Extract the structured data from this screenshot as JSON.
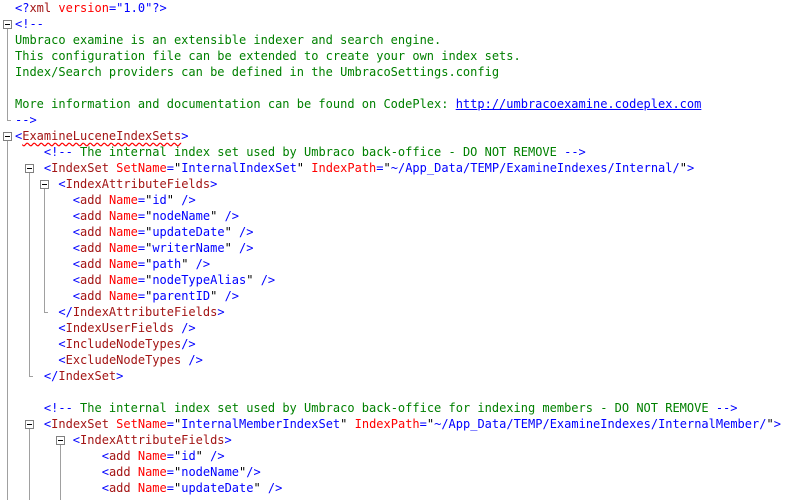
{
  "editor": {
    "lines": [
      [
        {
          "t": "<?",
          "c": "blue"
        },
        {
          "t": "xml",
          "c": "brown"
        },
        {
          "t": " version",
          "c": "red"
        },
        {
          "t": "=",
          "c": "blue"
        },
        {
          "t": "\"1.0\"",
          "c": "blue"
        },
        {
          "t": "?>",
          "c": "blue"
        }
      ],
      [
        {
          "t": "<!--",
          "c": "blue"
        }
      ],
      [
        {
          "t": "Umbraco examine is an extensible indexer and search engine.",
          "c": "green"
        }
      ],
      [
        {
          "t": "This configuration file can be extended to create your own index sets.",
          "c": "green"
        }
      ],
      [
        {
          "t": "Index/Search providers can be defined in the UmbracoSettings.config",
          "c": "green"
        }
      ],
      [],
      [
        {
          "t": "More information and documentation can be found on CodePlex: ",
          "c": "green"
        },
        {
          "t": "http://umbracoexamine.codeplex.com",
          "c": "link"
        }
      ],
      [
        {
          "t": "-->",
          "c": "blue"
        }
      ],
      [
        {
          "t": "<",
          "c": "blue"
        },
        {
          "t": "ExamineLuceneIndexSets",
          "c": "brown",
          "sq": true
        },
        {
          "t": ">",
          "c": "blue"
        }
      ],
      [
        {
          "t": "    "
        },
        {
          "t": "<!--",
          "c": "blue"
        },
        {
          "t": " The internal index set used by Umbraco back-office - DO NOT REMOVE ",
          "c": "green"
        },
        {
          "t": "-->",
          "c": "blue"
        }
      ],
      [
        {
          "t": "    "
        },
        {
          "t": "<",
          "c": "blue"
        },
        {
          "t": "IndexSet",
          "c": "brown"
        },
        {
          "t": " SetName",
          "c": "red"
        },
        {
          "t": "=",
          "c": "blue"
        },
        {
          "t": "\"",
          "c": "black"
        },
        {
          "t": "InternalIndexSet",
          "c": "blue"
        },
        {
          "t": "\"",
          "c": "black"
        },
        {
          "t": " IndexPath",
          "c": "red"
        },
        {
          "t": "=",
          "c": "blue"
        },
        {
          "t": "\"",
          "c": "black"
        },
        {
          "t": "~/App_Data/TEMP/ExamineIndexes/Internal/",
          "c": "blue"
        },
        {
          "t": "\"",
          "c": "black"
        },
        {
          "t": ">",
          "c": "blue"
        }
      ],
      [
        {
          "t": "      "
        },
        {
          "t": "<",
          "c": "blue"
        },
        {
          "t": "IndexAttributeFields",
          "c": "brown"
        },
        {
          "t": ">",
          "c": "blue"
        }
      ],
      [
        {
          "t": "        "
        },
        {
          "t": "<",
          "c": "blue"
        },
        {
          "t": "add",
          "c": "brown"
        },
        {
          "t": " Name",
          "c": "red"
        },
        {
          "t": "=",
          "c": "blue"
        },
        {
          "t": "\"",
          "c": "black"
        },
        {
          "t": "id",
          "c": "blue"
        },
        {
          "t": "\"",
          "c": "black"
        },
        {
          "t": " />",
          "c": "blue"
        }
      ],
      [
        {
          "t": "        "
        },
        {
          "t": "<",
          "c": "blue"
        },
        {
          "t": "add",
          "c": "brown"
        },
        {
          "t": " Name",
          "c": "red"
        },
        {
          "t": "=",
          "c": "blue"
        },
        {
          "t": "\"",
          "c": "black"
        },
        {
          "t": "nodeName",
          "c": "blue"
        },
        {
          "t": "\"",
          "c": "black"
        },
        {
          "t": " />",
          "c": "blue"
        }
      ],
      [
        {
          "t": "        "
        },
        {
          "t": "<",
          "c": "blue"
        },
        {
          "t": "add",
          "c": "brown"
        },
        {
          "t": " Name",
          "c": "red"
        },
        {
          "t": "=",
          "c": "blue"
        },
        {
          "t": "\"",
          "c": "black"
        },
        {
          "t": "updateDate",
          "c": "blue"
        },
        {
          "t": "\"",
          "c": "black"
        },
        {
          "t": " />",
          "c": "blue"
        }
      ],
      [
        {
          "t": "        "
        },
        {
          "t": "<",
          "c": "blue"
        },
        {
          "t": "add",
          "c": "brown"
        },
        {
          "t": " Name",
          "c": "red"
        },
        {
          "t": "=",
          "c": "blue"
        },
        {
          "t": "\"",
          "c": "black"
        },
        {
          "t": "writerName",
          "c": "blue"
        },
        {
          "t": "\"",
          "c": "black"
        },
        {
          "t": " />",
          "c": "blue"
        }
      ],
      [
        {
          "t": "        "
        },
        {
          "t": "<",
          "c": "blue"
        },
        {
          "t": "add",
          "c": "brown"
        },
        {
          "t": " Name",
          "c": "red"
        },
        {
          "t": "=",
          "c": "blue"
        },
        {
          "t": "\"",
          "c": "black"
        },
        {
          "t": "path",
          "c": "blue"
        },
        {
          "t": "\"",
          "c": "black"
        },
        {
          "t": " />",
          "c": "blue"
        }
      ],
      [
        {
          "t": "        "
        },
        {
          "t": "<",
          "c": "blue"
        },
        {
          "t": "add",
          "c": "brown"
        },
        {
          "t": " Name",
          "c": "red"
        },
        {
          "t": "=",
          "c": "blue"
        },
        {
          "t": "\"",
          "c": "black"
        },
        {
          "t": "nodeTypeAlias",
          "c": "blue"
        },
        {
          "t": "\"",
          "c": "black"
        },
        {
          "t": " />",
          "c": "blue"
        }
      ],
      [
        {
          "t": "        "
        },
        {
          "t": "<",
          "c": "blue"
        },
        {
          "t": "add",
          "c": "brown"
        },
        {
          "t": " Name",
          "c": "red"
        },
        {
          "t": "=",
          "c": "blue"
        },
        {
          "t": "\"",
          "c": "black"
        },
        {
          "t": "parentID",
          "c": "blue"
        },
        {
          "t": "\"",
          "c": "black"
        },
        {
          "t": " />",
          "c": "blue"
        }
      ],
      [
        {
          "t": "      "
        },
        {
          "t": "</",
          "c": "blue"
        },
        {
          "t": "IndexAttributeFields",
          "c": "brown"
        },
        {
          "t": ">",
          "c": "blue"
        }
      ],
      [
        {
          "t": "      "
        },
        {
          "t": "<",
          "c": "blue"
        },
        {
          "t": "IndexUserFields",
          "c": "brown"
        },
        {
          "t": " />",
          "c": "blue"
        }
      ],
      [
        {
          "t": "      "
        },
        {
          "t": "<",
          "c": "blue"
        },
        {
          "t": "IncludeNodeTypes",
          "c": "brown"
        },
        {
          "t": "/>",
          "c": "blue"
        }
      ],
      [
        {
          "t": "      "
        },
        {
          "t": "<",
          "c": "blue"
        },
        {
          "t": "ExcludeNodeTypes",
          "c": "brown"
        },
        {
          "t": " />",
          "c": "blue"
        }
      ],
      [
        {
          "t": "    "
        },
        {
          "t": "</",
          "c": "blue"
        },
        {
          "t": "IndexSet",
          "c": "brown"
        },
        {
          "t": ">",
          "c": "blue"
        }
      ],
      [],
      [
        {
          "t": "    "
        },
        {
          "t": "<!--",
          "c": "blue"
        },
        {
          "t": " The internal index set used by Umbraco back-office for indexing members - DO NOT REMOVE ",
          "c": "green"
        },
        {
          "t": "-->",
          "c": "blue"
        }
      ],
      [
        {
          "t": "    "
        },
        {
          "t": "<",
          "c": "blue"
        },
        {
          "t": "IndexSet",
          "c": "brown"
        },
        {
          "t": " SetName",
          "c": "red"
        },
        {
          "t": "=",
          "c": "blue"
        },
        {
          "t": "\"",
          "c": "black"
        },
        {
          "t": "InternalMemberIndexSet",
          "c": "blue"
        },
        {
          "t": "\"",
          "c": "black"
        },
        {
          "t": " IndexPath",
          "c": "red"
        },
        {
          "t": "=",
          "c": "blue"
        },
        {
          "t": "\"",
          "c": "black"
        },
        {
          "t": "~/App_Data/TEMP/ExamineIndexes/InternalMember/",
          "c": "blue"
        },
        {
          "t": "\"",
          "c": "black"
        },
        {
          "t": ">",
          "c": "blue"
        }
      ],
      [
        {
          "t": "        "
        },
        {
          "t": "<",
          "c": "blue"
        },
        {
          "t": "IndexAttributeFields",
          "c": "brown"
        },
        {
          "t": ">",
          "c": "blue"
        }
      ],
      [
        {
          "t": "            "
        },
        {
          "t": "<",
          "c": "blue"
        },
        {
          "t": "add",
          "c": "brown"
        },
        {
          "t": " Name",
          "c": "red"
        },
        {
          "t": "=",
          "c": "blue"
        },
        {
          "t": "\"",
          "c": "black"
        },
        {
          "t": "id",
          "c": "blue"
        },
        {
          "t": "\"",
          "c": "black"
        },
        {
          "t": " />",
          "c": "blue"
        }
      ],
      [
        {
          "t": "            "
        },
        {
          "t": "<",
          "c": "blue"
        },
        {
          "t": "add",
          "c": "brown"
        },
        {
          "t": " Name",
          "c": "red"
        },
        {
          "t": "=",
          "c": "blue"
        },
        {
          "t": "\"",
          "c": "black"
        },
        {
          "t": "nodeName",
          "c": "blue"
        },
        {
          "t": "\"",
          "c": "black"
        },
        {
          "t": "/>",
          "c": "blue"
        }
      ],
      [
        {
          "t": "            "
        },
        {
          "t": "<",
          "c": "blue"
        },
        {
          "t": "add",
          "c": "brown"
        },
        {
          "t": " Name",
          "c": "red"
        },
        {
          "t": "=",
          "c": "blue"
        },
        {
          "t": "\"",
          "c": "black"
        },
        {
          "t": "updateDate",
          "c": "blue"
        },
        {
          "t": "\"",
          "c": "black"
        },
        {
          "t": " />",
          "c": "blue"
        }
      ]
    ]
  },
  "colors": {
    "blue": "#0000ff",
    "brown": "#a31515",
    "red": "#ff0000",
    "green": "#008000",
    "link": "#0000ff",
    "black": "#000000"
  }
}
